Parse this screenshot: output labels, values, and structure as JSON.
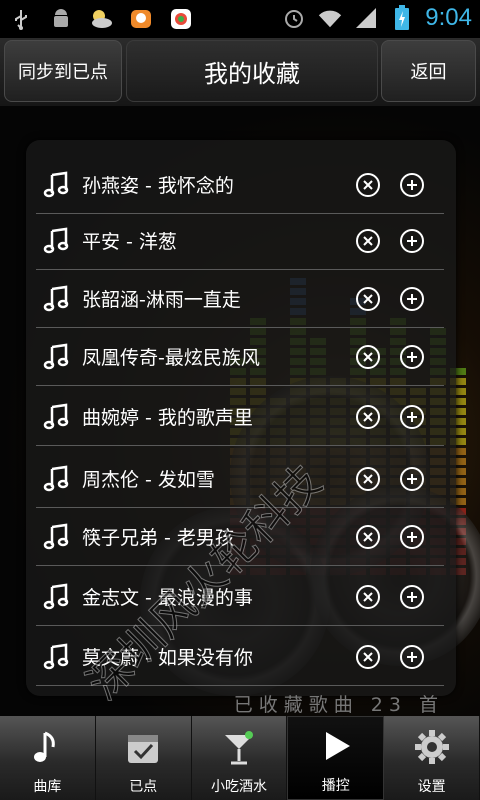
{
  "status_bar": {
    "time": "9:04",
    "icons": [
      "usb-icon",
      "android-icon",
      "weather-icon",
      "chat-icon",
      "app-icon",
      "alarm-icon",
      "wifi-icon",
      "signal-icon",
      "battery-icon"
    ]
  },
  "header": {
    "sync_label": "同步到已点",
    "title": "我的收藏",
    "back_label": "返回"
  },
  "songs": [
    "孙燕姿 - 我怀念的",
    "平安 - 洋葱",
    "张韶涵-淋雨一直走",
    "凤凰传奇-最炫民族风",
    "曲婉婷 - 我的歌声里",
    "周杰伦 - 发如雪",
    "筷子兄弟 - 老男孩",
    "金志文 - 最浪漫的事",
    "莫文蔚 - 如果没有你"
  ],
  "footer": {
    "count_text": "已收藏歌曲 23 首"
  },
  "watermark": "深圳风火轮科技",
  "tabs": [
    {
      "label": "曲库",
      "icon": "music-note-icon"
    },
    {
      "label": "已点",
      "icon": "calendar-check-icon"
    },
    {
      "label": "小吃酒水",
      "icon": "cocktail-icon"
    },
    {
      "label": "播控",
      "icon": "play-icon",
      "active": true
    },
    {
      "label": "设置",
      "icon": "gear-icon"
    }
  ],
  "colors": {
    "time": "#3fb7e8",
    "accent_bars": [
      "#e5332a",
      "#f5a623",
      "#f8e71c",
      "#7ed321",
      "#4a90e2"
    ]
  }
}
